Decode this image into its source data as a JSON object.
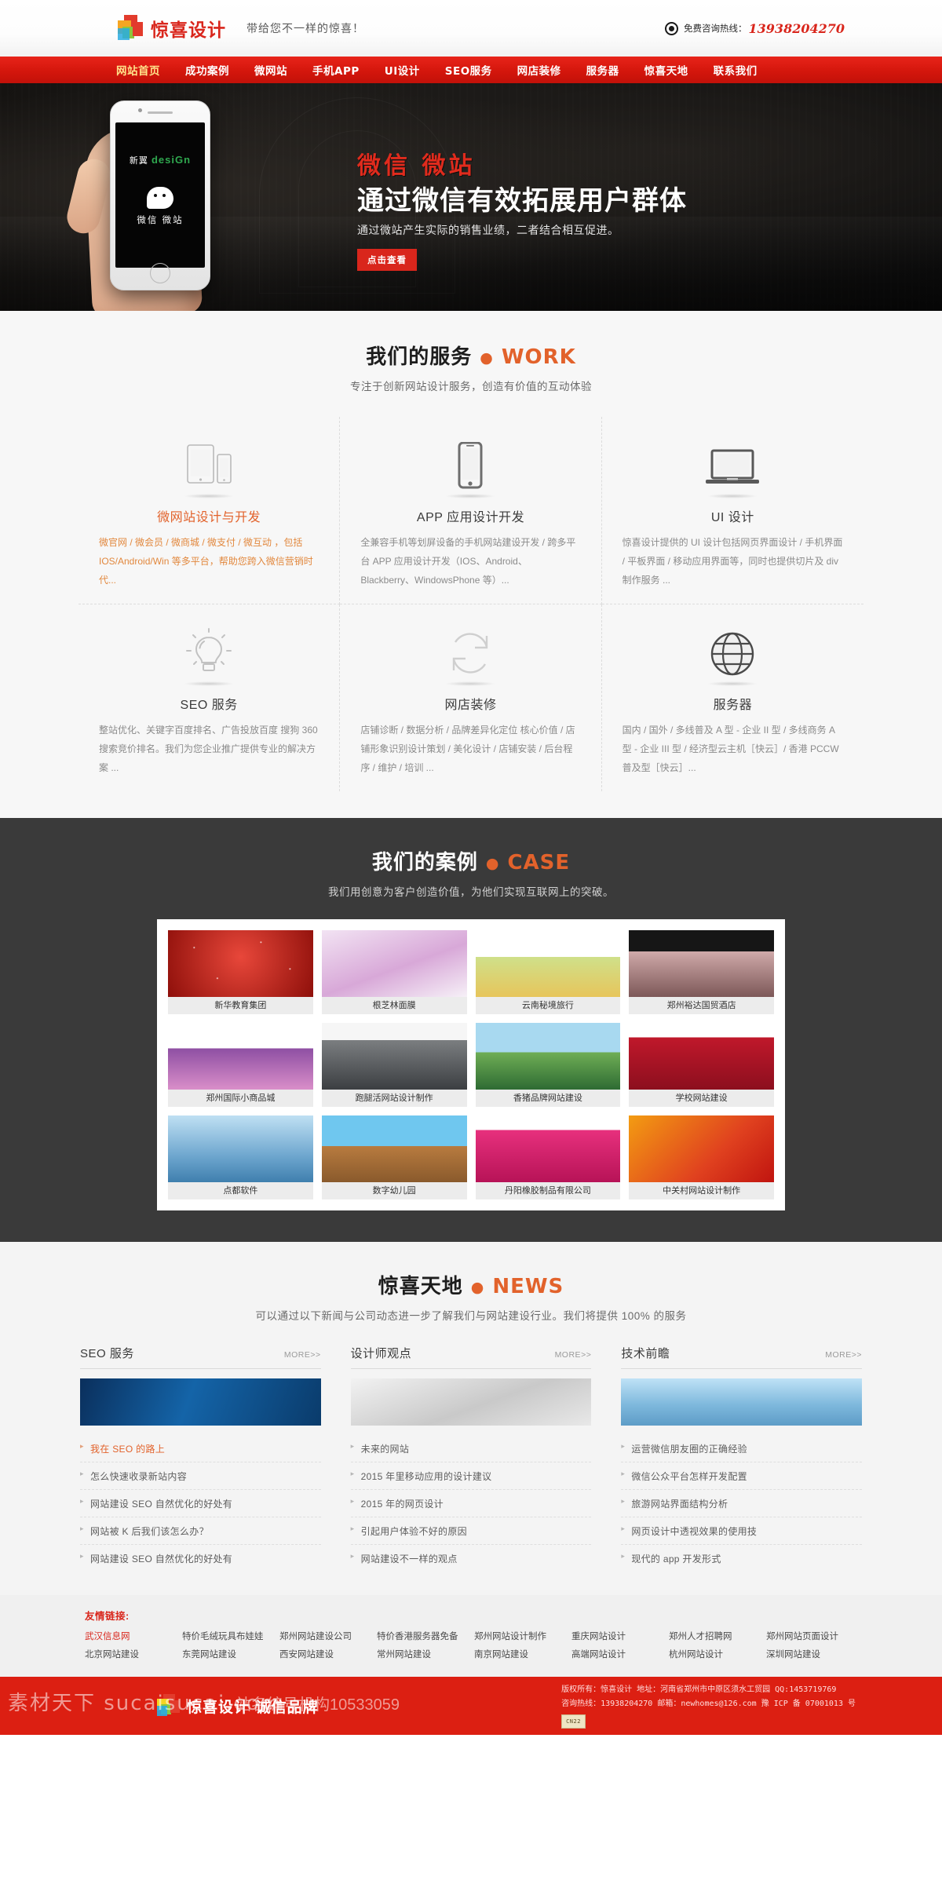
{
  "header": {
    "logo_text": "惊喜设计",
    "slogan": "带给您不一样的惊喜！",
    "hotline_label": "免费咨询热线：",
    "hotline_number": "13938204270",
    "phone_icon": "phone-icon"
  },
  "nav": {
    "items": [
      {
        "label": "网站首页",
        "active": true
      },
      {
        "label": "成功案例",
        "active": false
      },
      {
        "label": "微网站",
        "active": false
      },
      {
        "label": "手机APP",
        "active": false
      },
      {
        "label": "UI设计",
        "active": false
      },
      {
        "label": "SEO服务",
        "active": false
      },
      {
        "label": "网店装修",
        "active": false
      },
      {
        "label": "服务器",
        "active": false
      },
      {
        "label": "惊喜天地",
        "active": false
      },
      {
        "label": "联系我们",
        "active": false
      }
    ]
  },
  "hero": {
    "kicker": "微信 微站",
    "title": "通过微信有效拓展用户群体",
    "subtitle": "通过微站产生实际的销售业绩，二者结合相互促进。",
    "button": "点击查看",
    "phone_screen_brand": "新翼",
    "phone_screen_brand_en": "desiGn",
    "phone_screen_caption": "微信 微站"
  },
  "services": {
    "title_cn": "我们的服务",
    "title_en": "WORK",
    "subtitle": "专注于创新网站设计服务，创造有价值的互动体验",
    "items": [
      {
        "icon": "tablet-phone-icon",
        "name": "微网站设计与开发",
        "desc": "微官网 / 微会员 / 微商城 / 微支付 / 微互动 ，包括 IOS/Android/Win 等多平台，帮助您跨入微信营销时代...",
        "highlight": true
      },
      {
        "icon": "smartphone-icon",
        "name": "APP 应用设计开发",
        "desc": "全兼容手机等划屏设备的手机网站建设开发 / 跨多平台 APP 应用设计开发（IOS、Android、Blackberry、WindowsPhone 等）...",
        "highlight": false
      },
      {
        "icon": "laptop-icon",
        "name": "UI 设计",
        "desc": "惊喜设计提供的 UI 设计包括网页界面设计 / 手机界面 / 平板界面 / 移动应用界面等，同时也提供切片及 div 制作服务 ...",
        "highlight": false
      },
      {
        "icon": "lightbulb-icon",
        "name": "SEO 服务",
        "desc": "整站优化、关键字百度排名、广告投放百度 搜狗 360 搜索竞价排名。我们为您企业推广提供专业的解决方案 ...",
        "highlight": false
      },
      {
        "icon": "refresh-icon",
        "name": "网店装修",
        "desc": "店铺诊断 / 数据分析 / 品牌差异化定位 核心价值 / 店铺形象识别设计策划 / 美化设计 / 店铺安装 / 后台程序 / 维护 / 培训 ...",
        "highlight": false
      },
      {
        "icon": "globe-icon",
        "name": "服务器",
        "desc": "国内 / 国外 / 多线普及 A 型 - 企业 II 型 / 多线商务 A 型 - 企业 III 型 / 经济型云主机［快云］/ 香港 PCCW 普及型［快云］...",
        "highlight": false
      }
    ]
  },
  "cases": {
    "title_cn": "我们的案例",
    "title_en": "CASE",
    "subtitle": "我们用创意为客户创造价值，为他们实现互联网上的突破。",
    "items": [
      {
        "caption": "新华教育集团",
        "art": "t-red t-stars"
      },
      {
        "caption": "根芝林面膜",
        "art": "t-pink"
      },
      {
        "caption": "云南秘境旅行",
        "art": "t-white"
      },
      {
        "caption": "郑州裕达国贸酒店",
        "art": "t-black"
      },
      {
        "caption": "郑州国际小商品城",
        "art": "t-mall"
      },
      {
        "caption": "跑腿活网站设计制作",
        "art": "t-blue"
      },
      {
        "caption": "香猪品牌网站建设",
        "art": "t-green"
      },
      {
        "caption": "学校网站建设",
        "art": "t-crim"
      },
      {
        "caption": "点都软件",
        "art": "t-lblue"
      },
      {
        "caption": "数字幼儿园",
        "art": "t-kid"
      },
      {
        "caption": "丹阳橡胶制品有限公司",
        "art": "t-mag"
      },
      {
        "caption": "中关村网站设计制作",
        "art": "t-org"
      }
    ]
  },
  "news": {
    "title_cn": "惊喜天地",
    "title_en": "NEWS",
    "subtitle": "可以通过以下新闻与公司动态进一步了解我们与网站建设行业。我们将提供 100% 的服务",
    "more_label": "MORE>>",
    "columns": [
      {
        "title": "SEO 服务",
        "img": "ni-1",
        "items": [
          {
            "text": "我在 SEO 的路上",
            "hot": true
          },
          {
            "text": "怎么快速收录新站内容",
            "hot": false
          },
          {
            "text": "网站建设 SEO 自然优化的好处有",
            "hot": false
          },
          {
            "text": "网站被 K 后我们该怎么办？",
            "hot": false
          },
          {
            "text": "网站建设 SEO 自然优化的好处有",
            "hot": false
          }
        ]
      },
      {
        "title": "设计师观点",
        "img": "ni-2",
        "items": [
          {
            "text": "未来的网站",
            "hot": false
          },
          {
            "text": "2015 年里移动应用的设计建议",
            "hot": false
          },
          {
            "text": "2015 年的网页设计",
            "hot": false
          },
          {
            "text": "引起用户体验不好的原因",
            "hot": false
          },
          {
            "text": "网站建设不一样的观点",
            "hot": false
          }
        ]
      },
      {
        "title": "技术前瞻",
        "img": "ni-3",
        "items": [
          {
            "text": "运营微信朋友圈的正确经验",
            "hot": false
          },
          {
            "text": "微信公众平台怎样开发配置",
            "hot": false
          },
          {
            "text": "旅游网站界面结构分析",
            "hot": false
          },
          {
            "text": "网页设计中透视效果的使用技",
            "hot": false
          },
          {
            "text": "现代的 app 开发形式",
            "hot": false
          }
        ]
      }
    ]
  },
  "links": {
    "title": "友情链接:",
    "row1": [
      {
        "label": "武汉信息网",
        "hot": true
      },
      {
        "label": "特价毛绒玩具布娃娃",
        "hot": false
      },
      {
        "label": "郑州网站建设公司",
        "hot": false
      },
      {
        "label": "特价香港服务器免备",
        "hot": false
      },
      {
        "label": "郑州网站设计制作",
        "hot": false
      },
      {
        "label": "重庆网站设计",
        "hot": false
      },
      {
        "label": "郑州人才招聘网",
        "hot": false
      },
      {
        "label": "郑州网站页面设计",
        "hot": false
      }
    ],
    "row2": [
      {
        "label": "北京网站建设",
        "hot": false
      },
      {
        "label": "东莞网站建设",
        "hot": false
      },
      {
        "label": "西安网站建设",
        "hot": false
      },
      {
        "label": "常州网站建设",
        "hot": false
      },
      {
        "label": "南京网站建设",
        "hot": false
      },
      {
        "label": "高端网站设计",
        "hot": false
      },
      {
        "label": "杭州网站设计",
        "hot": false
      },
      {
        "label": "深圳网站建设",
        "hot": false
      }
    ]
  },
  "footer": {
    "brand": "惊喜设计  诚信品牌",
    "copyright_line1": "版权所有：惊喜设计 地址：河南省郑州市中原区须水工贸园 QQ:1453719769",
    "copyright_line2": "咨询热线：13938204270   邮箱：newhomes@126.com 豫 ICP 备 07001013 号",
    "badge": "CN22",
    "watermark_main": "素材天下 sucaisucai.com",
    "watermark_sub": "站名编号机构10533059"
  },
  "colors": {
    "brand_red": "#d9261c",
    "nav_red": "#d4160c",
    "accent_orange": "#e2622b",
    "dark_section": "#3a3a3a"
  }
}
